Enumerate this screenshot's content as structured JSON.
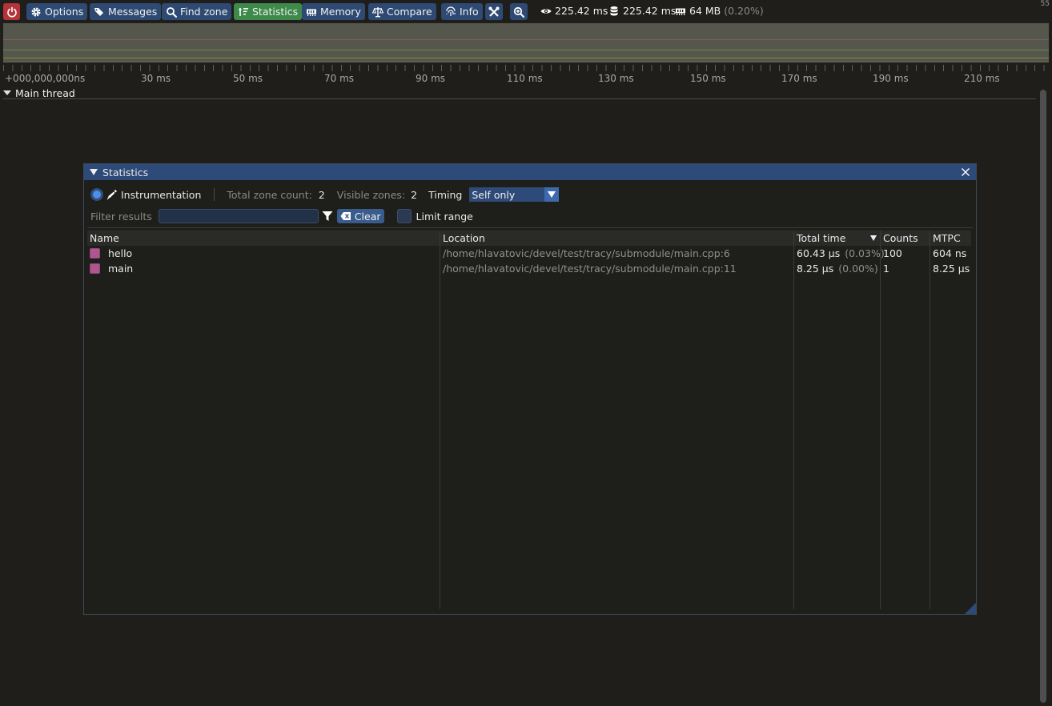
{
  "toolbar": {
    "options": "Options",
    "messages": "Messages",
    "find_zone": "Find zone",
    "statistics": "Statistics",
    "memory": "Memory",
    "compare": "Compare",
    "info": "Info",
    "view_time": "225.42 ms",
    "db_time": "225.42 ms",
    "memory_usage": "64 MB",
    "memory_pct": "(0.20%)",
    "fps": "55"
  },
  "timeline": {
    "ticks": [
      "+000,000,000ns",
      "30 ms",
      "50 ms",
      "70 ms",
      "90 ms",
      "110 ms",
      "130 ms",
      "150 ms",
      "170 ms",
      "190 ms",
      "210 ms"
    ],
    "thread_name": "Main thread"
  },
  "statistics": {
    "title": "Statistics",
    "mode_label": "Instrumentation",
    "total_zone_count_label": "Total zone count:",
    "total_zone_count": "2",
    "visible_zones_label": "Visible zones:",
    "visible_zones": "2",
    "timing_label": "Timing",
    "timing_value": "Self only",
    "filter_label": "Filter results",
    "filter_value": "",
    "clear_label": "Clear",
    "limit_range_label": "Limit range",
    "columns": [
      "Name",
      "Location",
      "Total time",
      "Counts",
      "MTPC"
    ],
    "rows": [
      {
        "name": "hello",
        "location": "/home/hlavatovic/devel/test/tracy/submodule/main.cpp:6",
        "total_time": "60.43 μs",
        "total_pct": "(0.03%)",
        "counts": "100",
        "mtpc": "604 ns",
        "color": "#b0558f"
      },
      {
        "name": "main",
        "location": "/home/hlavatovic/devel/test/tracy/submodule/main.cpp:11",
        "total_time": "8.25 μs",
        "total_pct": "(0.00%)",
        "counts": "1",
        "mtpc": "8.25 μs",
        "color": "#b0558f"
      }
    ]
  }
}
